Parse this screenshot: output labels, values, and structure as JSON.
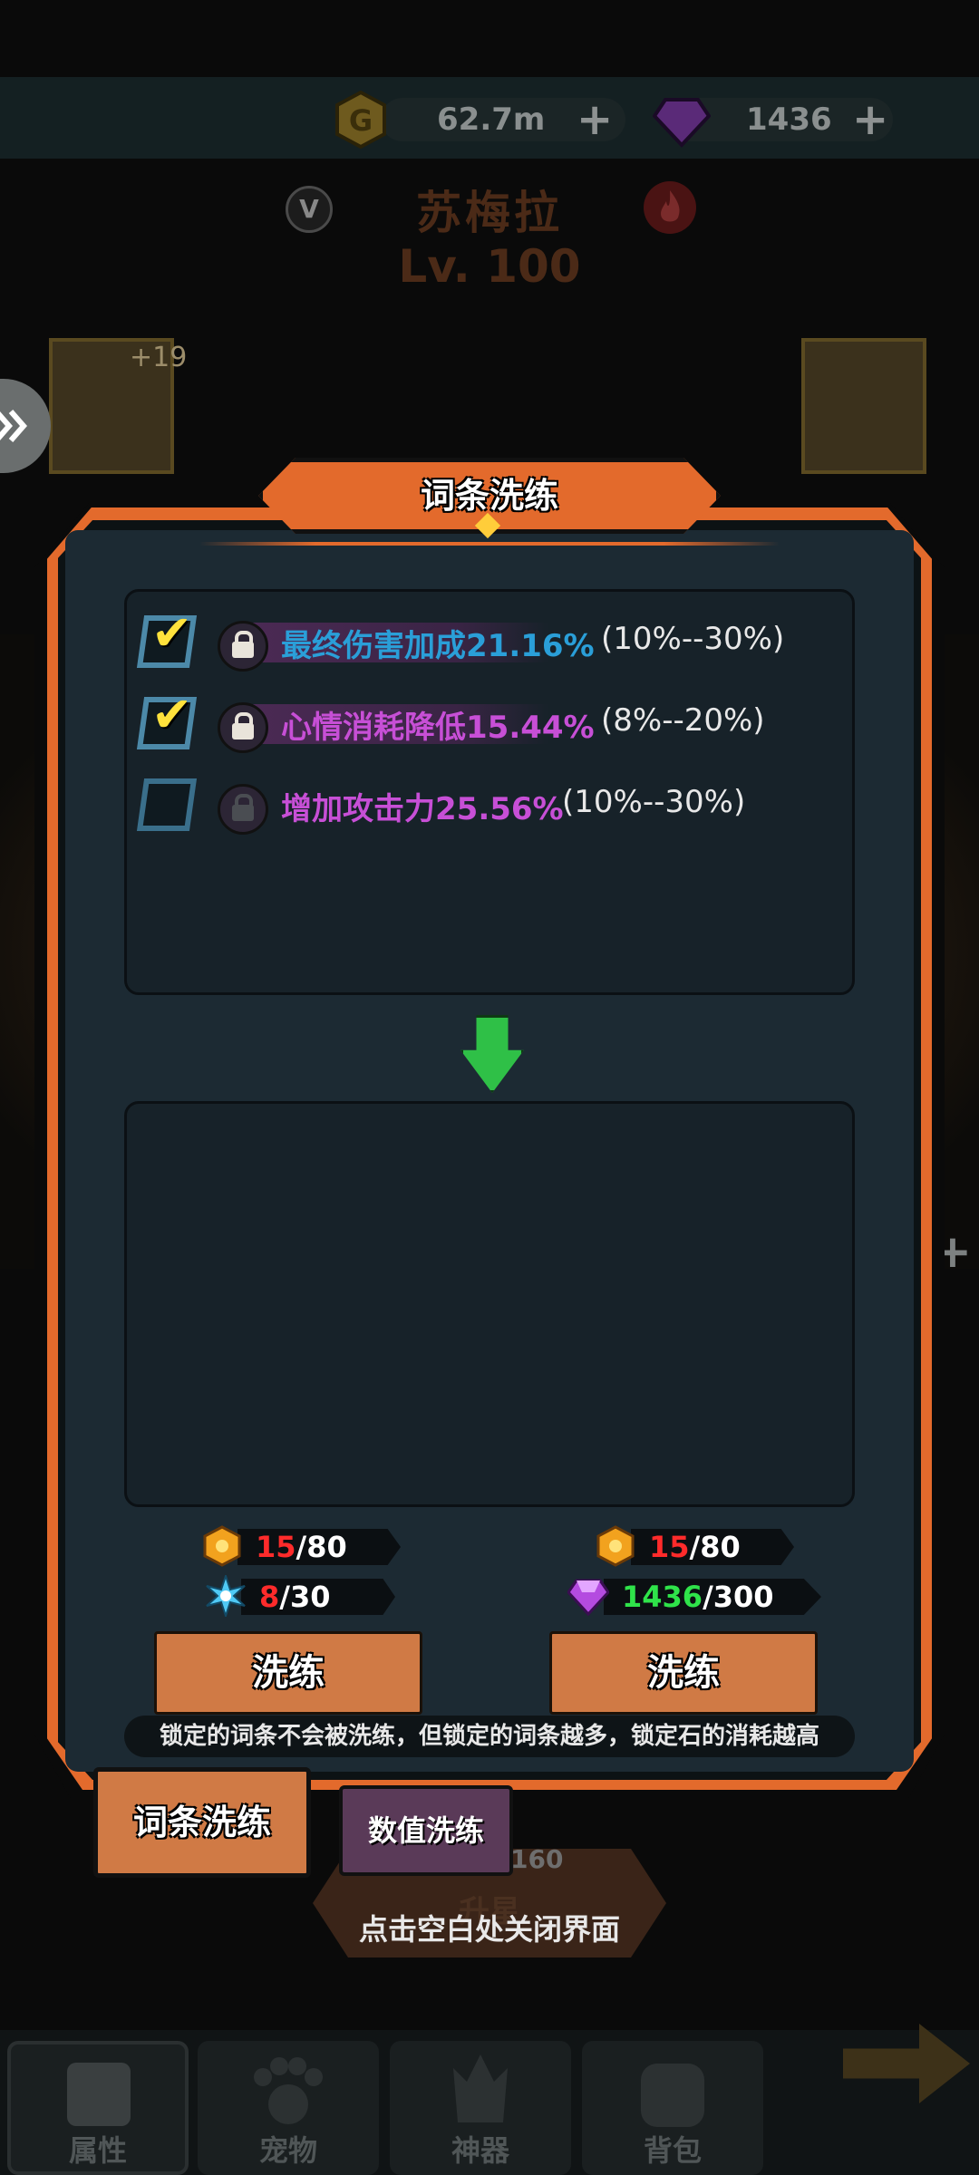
{
  "resources": {
    "gold": "62.7m",
    "gems": "1436"
  },
  "character": {
    "name": "苏梅拉",
    "level": "Lv. 100",
    "vip_badge": "V"
  },
  "equipment": {
    "left_slot_plus": "+19"
  },
  "dialog": {
    "title": "词条洗练",
    "current_attributes": [
      {
        "locked": true,
        "name": "最终伤害加成21.16%",
        "range": "(10%--30%)",
        "color": "#2a9fd8"
      },
      {
        "locked": true,
        "name": "心情消耗降低15.44%",
        "range": "(8%--20%)",
        "color": "#c74fd6"
      },
      {
        "locked": false,
        "name": "增加攻击力25.56%",
        "range": "(10%--30%)",
        "color": "#c74fd6"
      }
    ],
    "left_cost": {
      "lock_stone": {
        "have": "15",
        "need": "/80"
      },
      "wash_stone": {
        "have": "8",
        "need": "/30"
      }
    },
    "right_cost": {
      "lock_stone": {
        "have": "15",
        "need": "/80"
      },
      "gem": {
        "have": "1436",
        "need": "/300"
      }
    },
    "wash_button_left": "洗练",
    "wash_button_right": "洗练",
    "notice": "锁定的词条不会被洗练，但锁定的词条越多，锁定石的消耗越高",
    "tabs": {
      "affix_wash": "词条洗练",
      "value_wash": "数值洗练"
    }
  },
  "behind": {
    "upgrade_cost": "160",
    "upgrade_label": "升星"
  },
  "close_hint": "点击空白处关闭界面",
  "bottom_nav": [
    "属性",
    "宠物",
    "神器",
    "背包"
  ],
  "colors": {
    "accent_orange": "#e36a2c",
    "insufficient_red": "#ff2b2b",
    "sufficient_green": "#2fe34a",
    "panel": "#1c2a33"
  }
}
